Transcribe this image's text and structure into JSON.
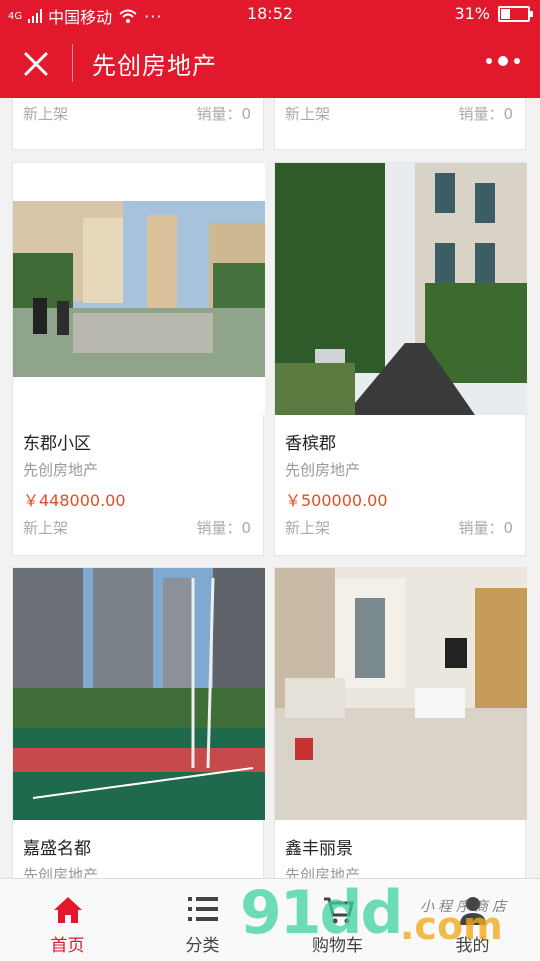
{
  "status_bar": {
    "carrier": "中国移动",
    "signal": "4G",
    "time": "18:52",
    "battery": "31%",
    "battery_level": 0.31
  },
  "nav": {
    "title": "先创房地产"
  },
  "top_row": [
    {
      "tag": "新上架",
      "sales": "销量：0"
    },
    {
      "tag": "新上架",
      "sales": "销量：0"
    }
  ],
  "products": [
    {
      "name": "东郡小区",
      "shop": "先创房地产",
      "price": "￥448000.00",
      "tag": "新上架",
      "sales": "销量：0"
    },
    {
      "name": "香槟郡",
      "shop": "先创房地产",
      "price": "￥500000.00",
      "tag": "新上架",
      "sales": "销量：0"
    },
    {
      "name": "嘉盛名都",
      "shop": "先创房地产"
    },
    {
      "name": "鑫丰丽景",
      "shop": "先创房地产"
    }
  ],
  "tabs": [
    {
      "label": "首页"
    },
    {
      "label": "分类"
    },
    {
      "label": "购物车"
    },
    {
      "label": "我的"
    }
  ],
  "watermark": {
    "text": "91dd",
    "suffix": ".com",
    "slogan": "小程序商店"
  },
  "colors": {
    "brand": "#e2192c",
    "price": "#e44d26"
  }
}
